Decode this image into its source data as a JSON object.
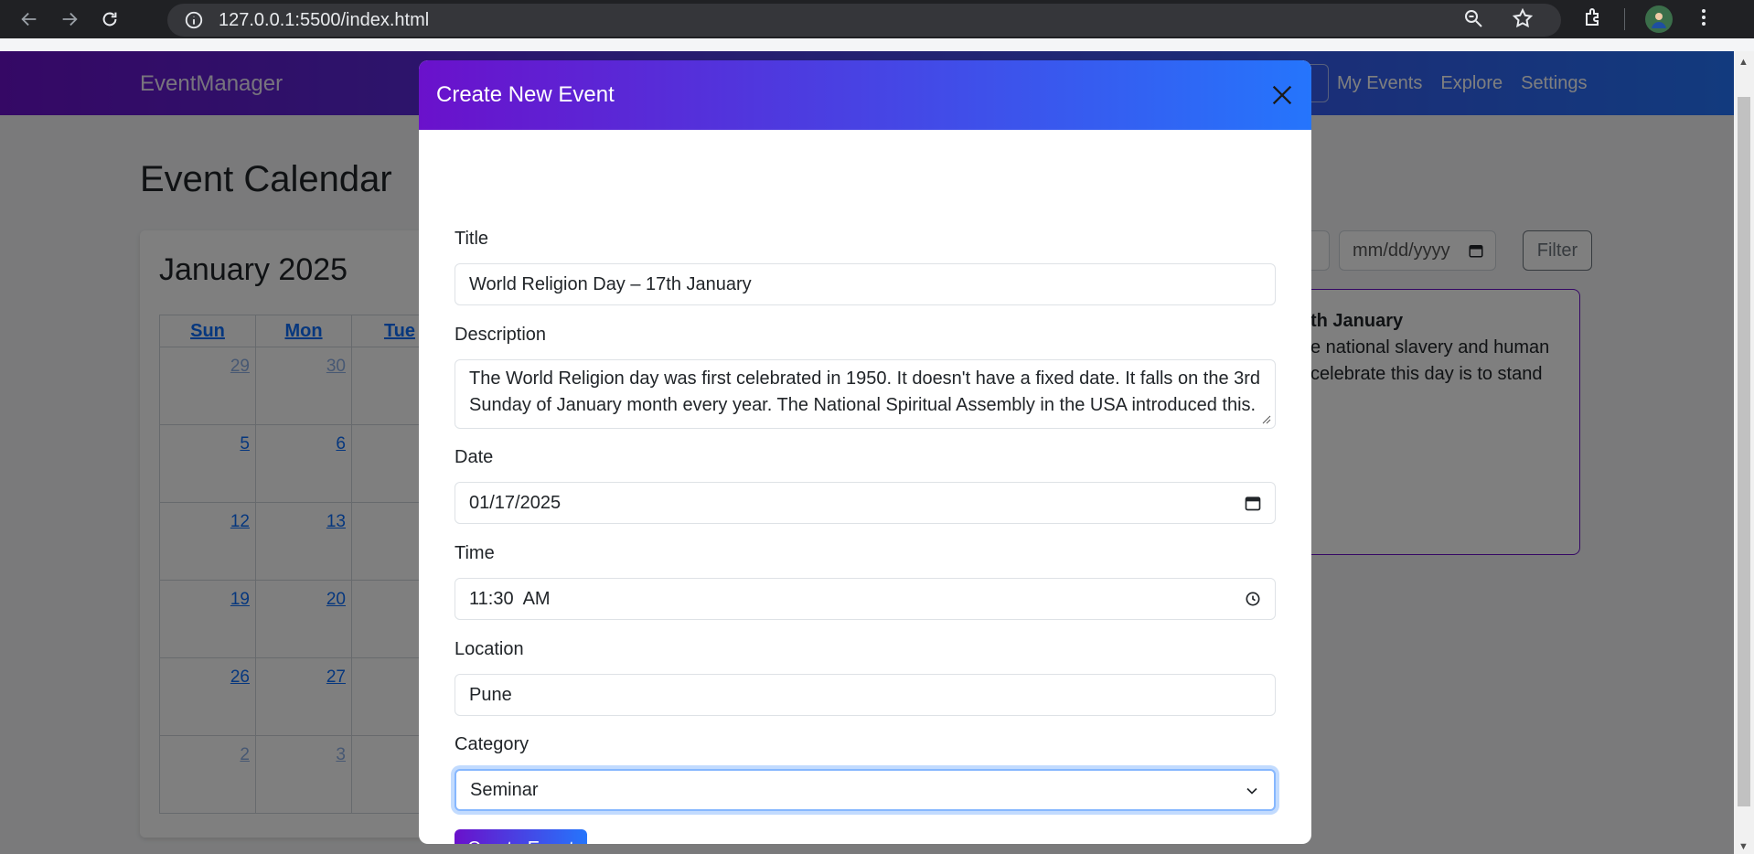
{
  "browser": {
    "url": "127.0.0.1:5500/index.html"
  },
  "navbar": {
    "brand": "EventManager",
    "links": [
      "My Events",
      "Explore",
      "Settings"
    ]
  },
  "page": {
    "title": "Event Calendar",
    "calendar": {
      "month": "January 2025",
      "weekdays": [
        "Sun",
        "Mon",
        "Tue"
      ],
      "rows": [
        [
          "29",
          "30"
        ],
        [
          "5",
          "6"
        ],
        [
          "12",
          "13"
        ],
        [
          "19",
          "20"
        ],
        [
          "26",
          "27"
        ],
        [
          "2",
          "3"
        ]
      ]
    },
    "filter": {
      "date_placeholder": "mm/dd/yyyy",
      "button_label": "Filter"
    },
    "event_card": {
      "title_fragment": "th January",
      "lines": [
        "e national slavery and human",
        "celebrate this day is to stand"
      ]
    }
  },
  "modal": {
    "title": "Create New Event",
    "fields": {
      "title": {
        "label": "Title",
        "value": "World Religion Day – 17th January"
      },
      "description": {
        "label": "Description",
        "value": "The World Religion day was first celebrated in 1950. It doesn't have a fixed date. It falls on the 3rd Sunday of January month every year. The National Spiritual Assembly in the USA introduced this."
      },
      "date": {
        "label": "Date",
        "value": "01/17/2025"
      },
      "time": {
        "label": "Time",
        "value": "11:30  AM"
      },
      "location": {
        "label": "Location",
        "value": "Pune"
      },
      "category": {
        "label": "Category",
        "value": "Seminar"
      }
    },
    "submit_label": "Create Event"
  }
}
